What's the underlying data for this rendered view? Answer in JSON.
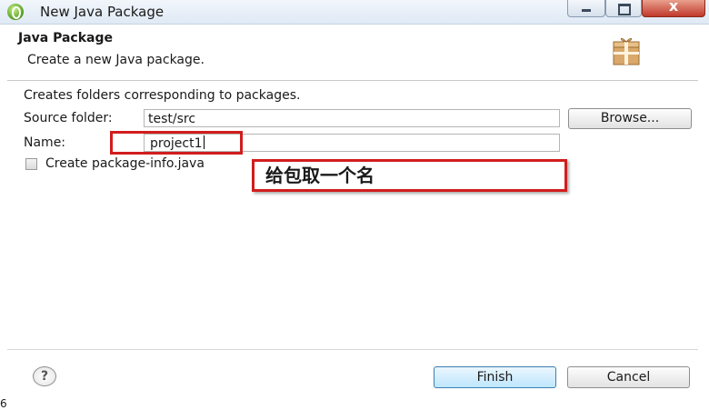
{
  "window": {
    "title": "New Java Package",
    "close_glyph": "x"
  },
  "banner": {
    "title": "Java Package",
    "description": "Create a new Java package.",
    "icon": "package-box-icon"
  },
  "form": {
    "intro": "Creates folders corresponding to packages.",
    "source_folder_label": "Source folder:",
    "source_folder_value": "test/src",
    "browse_label": "Browse...",
    "name_label": "Name:",
    "name_value": "project1",
    "checkbox_label": "Create package-info.java",
    "checkbox_checked": false
  },
  "annotation": {
    "text": "给包取一个名",
    "color": "#d11d1d"
  },
  "footer": {
    "help_glyph": "?",
    "finish_label": "Finish",
    "cancel_label": "Cancel",
    "page_number": "6"
  }
}
